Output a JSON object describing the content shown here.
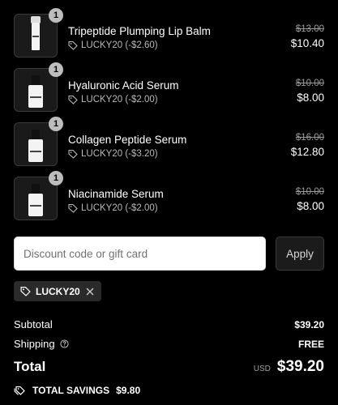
{
  "items": [
    {
      "name": "Tripeptide Plumping Lip Balm",
      "quantity": "1",
      "discount": "LUCKY20 (-$2.60)",
      "original_price": "$13.00",
      "final_price": "$10.40",
      "thumb_icon": "lip-balm-tube"
    },
    {
      "name": "Hyaluronic Acid Serum",
      "quantity": "1",
      "discount": "LUCKY20 (-$2.00)",
      "original_price": "$10.00",
      "final_price": "$8.00",
      "thumb_icon": "serum-dropper-bottle"
    },
    {
      "name": "Collagen Peptide Serum",
      "quantity": "1",
      "discount": "LUCKY20 (-$3.20)",
      "original_price": "$16.00",
      "final_price": "$12.80",
      "thumb_icon": "serum-dropper-bottle"
    },
    {
      "name": "Niacinamide Serum",
      "quantity": "1",
      "discount": "LUCKY20 (-$2.00)",
      "original_price": "$10.00",
      "final_price": "$8.00",
      "thumb_icon": "serum-dropper-bottle"
    }
  ],
  "discount_form": {
    "placeholder": "Discount code or gift card",
    "value": "",
    "apply_label": "Apply"
  },
  "applied_code": {
    "code": "LUCKY20"
  },
  "totals": {
    "subtotal_label": "Subtotal",
    "subtotal_value": "$39.20",
    "shipping_label": "Shipping",
    "shipping_value": "FREE",
    "total_label": "Total",
    "currency": "USD",
    "total_value": "$39.20",
    "savings_label": "TOTAL SAVINGS",
    "savings_value": "$9.80"
  },
  "colors": {
    "background": "#000000",
    "text": "#ffffff",
    "muted": "#b8b8b8",
    "input_bg": "#ffffff",
    "button_bg": "#1b1b1b",
    "chip_bg": "#2a2a2a",
    "qty_badge": "#bdbdbd"
  }
}
